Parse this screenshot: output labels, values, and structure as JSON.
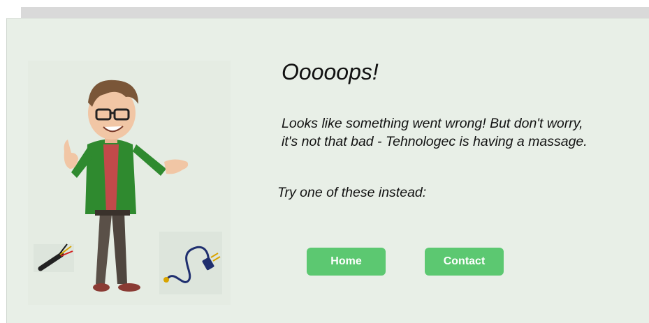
{
  "page": {
    "title": "Ooooops!",
    "message_line1": "Looks like something went wrong! But don't worry,",
    "message_line2": "it's not that bad - Tehnologec is having a massage.",
    "suggestion": "Try one of these instead:"
  },
  "buttons": {
    "home_label": "Home",
    "contact_label": "Contact"
  },
  "colors": {
    "background": "#e8efe7",
    "button": "#5cc871",
    "button_text": "#ffffff",
    "text": "#111111"
  },
  "illustration": {
    "character": "cartoon-man-thumbs-up",
    "items": [
      "cut-cable-icon",
      "power-plug-cable-icon"
    ]
  }
}
